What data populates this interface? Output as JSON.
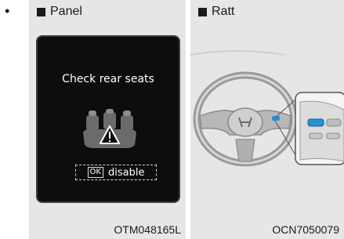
{
  "bullet": "•",
  "left_panel": {
    "header": "Panel",
    "screen_title": "Check rear seats",
    "ok_key": "OK",
    "disable_label": "disable",
    "code": "OTM048165L"
  },
  "right_panel": {
    "header": "Ratt",
    "code": "OCN7050079"
  },
  "colors": {
    "panel_bg": "#e6e6e6",
    "screen_bg": "#0d0d0d",
    "accent_button": "#2a8fd6"
  },
  "icons": [
    "square-bullet-icon",
    "rear-seats-warning-icon",
    "steering-wheel-illustration"
  ]
}
